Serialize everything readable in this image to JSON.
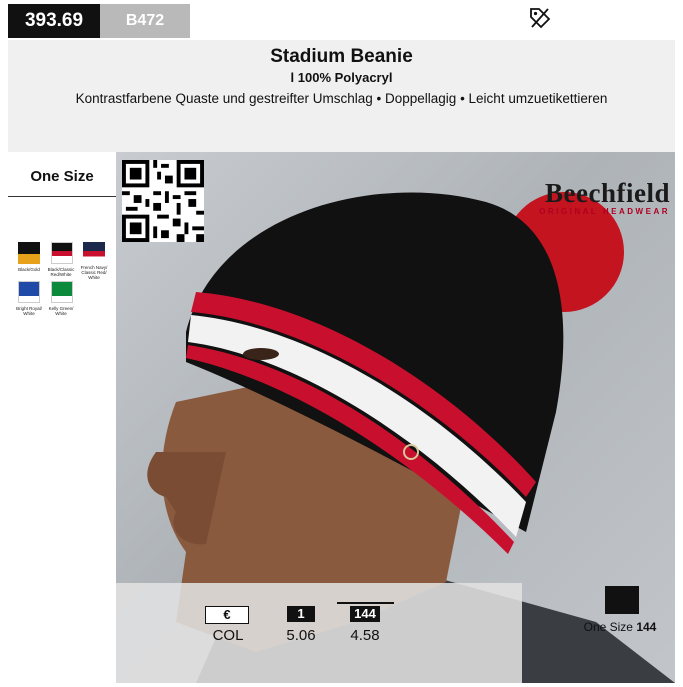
{
  "top": {
    "page_number": "393.69",
    "product_code": "B472"
  },
  "header": {
    "title": "Stadium Beanie",
    "subtitle": "l 100% Polyacryl",
    "description": "Kontrastfarbene Quaste und gestreifter Umschlag • Doppellagig • Leicht umzuetikettieren"
  },
  "sizes": {
    "label": "One Size"
  },
  "swatches": [
    {
      "top": "#111111",
      "bottom": "#e8a11a",
      "label": "Black/Gold"
    },
    {
      "top": "#c8102e",
      "bottom": "#ffffff",
      "label": "Black/Classic Red/White"
    },
    {
      "top": "#1b2a4a",
      "bottom": "#c8102e",
      "label": "French Navy/ Classic Red/ White"
    },
    {
      "top": "#1f4aa8",
      "bottom": "#ffffff",
      "label": "Bright Royal/ White"
    },
    {
      "top": "#0a8a3a",
      "bottom": "#ffffff",
      "label": "Kelly Green/ White"
    }
  ],
  "brand": {
    "name": "Beechfield",
    "tagline": "ORIGINAL HEADWEAR"
  },
  "pricing": {
    "currency_label": "€",
    "col_label": "COL",
    "qty1_label": "1",
    "qty1_price": "5.06",
    "qty2_label": "144",
    "qty2_price": "4.58"
  },
  "packing": {
    "size_label": "One Size",
    "quantity": "144"
  }
}
